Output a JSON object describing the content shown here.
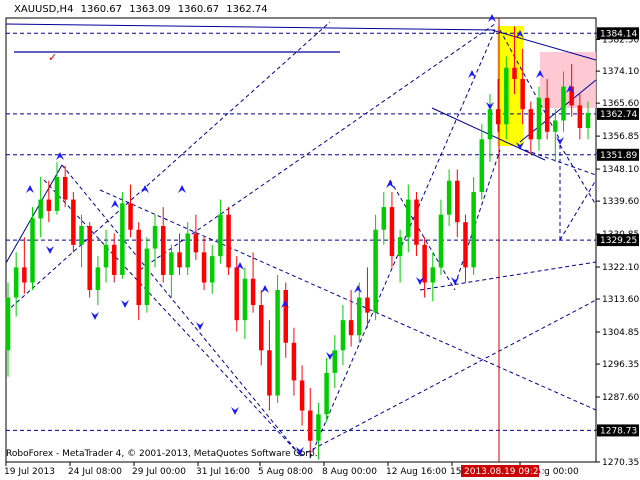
{
  "header": {
    "symbol": "XAUUSD,H4",
    "open": "1360.67",
    "high": "1363.09",
    "low": "1360.67",
    "close": "1362.74"
  },
  "copyright": "RoboForex - MetaTrader 4, © 2001-2013, MetaQuotes Software Corp.",
  "chart_data": {
    "type": "candlestick",
    "y_ticks": [
      "1384.15",
      "1382.50",
      "1374.10",
      "1365.60",
      "1356.85",
      "1348.10",
      "1339.60",
      "1330.85",
      "1322.10",
      "1313.60",
      "1304.85",
      "1296.35",
      "1287.60",
      "1278.85",
      "1270.35"
    ],
    "x_ticks": [
      "19 Jul 2013",
      "24 Jul 08:00",
      "29 Jul 00:00",
      "31 Jul 16:00",
      "5 Aug 08:00",
      "8 Aug 00:00",
      "12 Aug 16:00",
      "15 Aug",
      "19 Aug 00:00"
    ],
    "price_labels": [
      {
        "value": "1384.14",
        "color": "#ffffff",
        "bg": "#000000"
      },
      {
        "value": "1362.74",
        "color": "#ffffff",
        "bg": "#000000"
      },
      {
        "value": "1351.89",
        "color": "#ffffff",
        "bg": "#000000"
      },
      {
        "value": "1329.25",
        "color": "#ffffff",
        "bg": "#000000"
      },
      {
        "value": "1278.73",
        "color": "#ffffff",
        "bg": "#000000"
      }
    ],
    "time_marker": {
      "label": "2013.08.19 09:25",
      "color": "#cc0000"
    },
    "colors": {
      "bull": "#00cc00",
      "bear": "#ff0000",
      "lines": "#000099",
      "yellow_zone": "#ffff00",
      "pink_zone": "#ffc0cb",
      "marker": "#cc0000",
      "arrow": "#1a1aff"
    },
    "ohlc": [
      [
        1300,
        1318,
        1293,
        1314
      ],
      [
        1314,
        1326,
        1309,
        1322
      ],
      [
        1322,
        1330,
        1315,
        1318
      ],
      [
        1318,
        1338,
        1316,
        1335
      ],
      [
        1335,
        1346,
        1330,
        1340
      ],
      [
        1340,
        1345,
        1334,
        1337
      ],
      [
        1337,
        1350,
        1336,
        1346
      ],
      [
        1346,
        1349,
        1338,
        1340
      ],
      [
        1340,
        1342,
        1326,
        1328
      ],
      [
        1328,
        1336,
        1322,
        1333
      ],
      [
        1333,
        1334,
        1314,
        1316
      ],
      [
        1316,
        1325,
        1312,
        1322
      ],
      [
        1322,
        1332,
        1318,
        1328
      ],
      [
        1328,
        1331,
        1318,
        1320
      ],
      [
        1320,
        1342,
        1319,
        1339
      ],
      [
        1339,
        1344,
        1330,
        1332
      ],
      [
        1332,
        1334,
        1308,
        1312
      ],
      [
        1312,
        1330,
        1310,
        1327
      ],
      [
        1327,
        1336,
        1322,
        1333
      ],
      [
        1333,
        1338,
        1318,
        1320
      ],
      [
        1320,
        1328,
        1314,
        1326
      ],
      [
        1326,
        1331,
        1320,
        1322
      ],
      [
        1322,
        1334,
        1320,
        1331
      ],
      [
        1331,
        1336,
        1324,
        1326
      ],
      [
        1326,
        1330,
        1316,
        1318
      ],
      [
        1318,
        1328,
        1315,
        1325
      ],
      [
        1325,
        1340,
        1323,
        1336
      ],
      [
        1336,
        1338,
        1320,
        1322
      ],
      [
        1322,
        1325,
        1305,
        1308
      ],
      [
        1308,
        1322,
        1303,
        1319
      ],
      [
        1319,
        1326,
        1310,
        1312
      ],
      [
        1312,
        1316,
        1296,
        1300
      ],
      [
        1300,
        1308,
        1284,
        1288
      ],
      [
        1288,
        1320,
        1286,
        1316
      ],
      [
        1316,
        1318,
        1298,
        1302
      ],
      [
        1302,
        1306,
        1288,
        1292
      ],
      [
        1292,
        1296,
        1280,
        1284
      ],
      [
        1284,
        1290,
        1272,
        1276
      ],
      [
        1276,
        1286,
        1271,
        1283
      ],
      [
        1283,
        1298,
        1281,
        1294
      ],
      [
        1294,
        1304,
        1290,
        1300
      ],
      [
        1300,
        1312,
        1296,
        1308
      ],
      [
        1308,
        1316,
        1301,
        1304
      ],
      [
        1304,
        1318,
        1302,
        1314
      ],
      [
        1314,
        1322,
        1306,
        1310
      ],
      [
        1310,
        1336,
        1308,
        1332
      ],
      [
        1332,
        1342,
        1328,
        1338
      ],
      [
        1338,
        1342,
        1322,
        1325
      ],
      [
        1325,
        1332,
        1318,
        1330
      ],
      [
        1330,
        1344,
        1326,
        1340
      ],
      [
        1340,
        1342,
        1325,
        1328
      ],
      [
        1328,
        1330,
        1314,
        1318
      ],
      [
        1318,
        1326,
        1313,
        1322
      ],
      [
        1322,
        1340,
        1320,
        1336
      ],
      [
        1336,
        1348,
        1333,
        1345
      ],
      [
        1345,
        1348,
        1330,
        1334
      ],
      [
        1334,
        1336,
        1318,
        1322
      ],
      [
        1322,
        1346,
        1320,
        1342
      ],
      [
        1342,
        1360,
        1340,
        1356
      ],
      [
        1356,
        1368,
        1350,
        1364
      ],
      [
        1364,
        1372,
        1358,
        1360
      ],
      [
        1360,
        1378,
        1356,
        1375
      ],
      [
        1375,
        1386,
        1368,
        1372
      ],
      [
        1372,
        1380,
        1360,
        1364
      ],
      [
        1364,
        1366,
        1352,
        1356
      ],
      [
        1356,
        1370,
        1353,
        1367
      ],
      [
        1367,
        1372,
        1356,
        1358
      ],
      [
        1358,
        1364,
        1350,
        1361
      ],
      [
        1361,
        1374,
        1358,
        1370
      ],
      [
        1370,
        1376,
        1362,
        1365
      ],
      [
        1365,
        1368,
        1356,
        1359
      ],
      [
        1359,
        1366,
        1356,
        1363
      ]
    ]
  }
}
